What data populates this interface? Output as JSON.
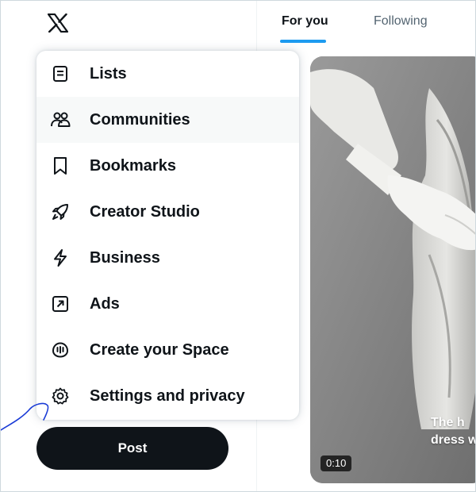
{
  "tabs": {
    "for_you": "For you",
    "following": "Following"
  },
  "menu": {
    "items": [
      {
        "label": "Lists",
        "icon": "list-icon"
      },
      {
        "label": "Communities",
        "icon": "communities-icon"
      },
      {
        "label": "Bookmarks",
        "icon": "bookmark-icon"
      },
      {
        "label": "Creator Studio",
        "icon": "rocket-icon"
      },
      {
        "label": "Business",
        "icon": "lightning-icon"
      },
      {
        "label": "Ads",
        "icon": "arrow-up-right-box-icon"
      },
      {
        "label": "Create your Space",
        "icon": "space-mic-icon"
      },
      {
        "label": "Settings and privacy",
        "icon": "gear-icon"
      }
    ],
    "hovered_item": "Communities"
  },
  "post_button": {
    "label": "Post"
  },
  "media": {
    "caption": "The h\ndress w",
    "duration": "0:10"
  },
  "colors": {
    "accent": "#1d9bf0",
    "text_primary": "#0f1419",
    "text_secondary": "#536471",
    "hover_bg": "#f7f9f9",
    "post_button_bg": "#0f1419"
  }
}
